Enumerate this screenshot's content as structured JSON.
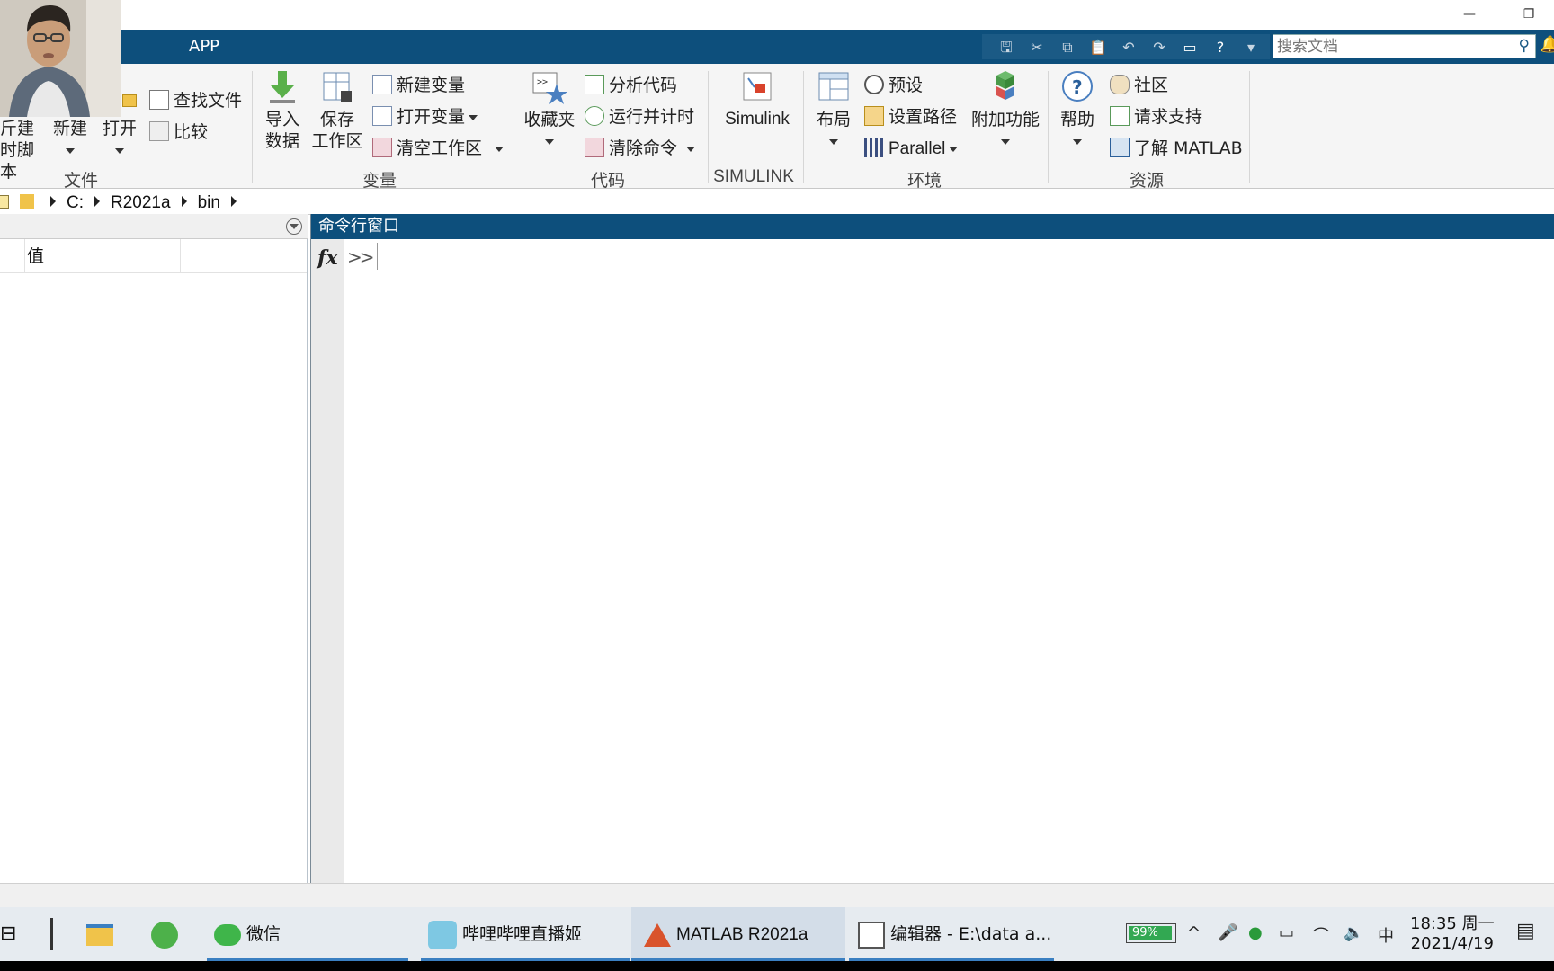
{
  "tabs": {
    "app": "APP"
  },
  "search": {
    "placeholder": "搜索文档"
  },
  "ribbon": {
    "file": {
      "label": "文件",
      "new_script_line1": "新建",
      "new_script_line2": "实时脚本",
      "new_script_visible1": "斤建",
      "new_script_visible2": "时脚本",
      "new": "新建",
      "open": "打开",
      "find_files": "查找文件",
      "compare": "比较"
    },
    "variable": {
      "label": "变量",
      "import_l1": "导入",
      "import_l2": "数据",
      "save_l1": "保存",
      "save_l2": "工作区",
      "new_var": "新建变量",
      "open_var": "打开变量",
      "clear_ws": "清空工作区"
    },
    "code": {
      "label": "代码",
      "favorites": "收藏夹",
      "analyze": "分析代码",
      "run_time": "运行并计时",
      "clear_cmd": "清除命令"
    },
    "simulink": {
      "label": "SIMULINK",
      "button": "Simulink"
    },
    "environment": {
      "label": "环境",
      "layout": "布局",
      "preferences": "预设",
      "set_path": "设置路径",
      "parallel": "Parallel",
      "addons": "附加功能"
    },
    "resources": {
      "label": "资源",
      "help": "帮助",
      "community": "社区",
      "support": "请求支持",
      "learn": "了解 MATLAB"
    }
  },
  "address": {
    "drive": "C:",
    "folder1": "R2021a",
    "folder2": "bin"
  },
  "workspace": {
    "col_value": "值"
  },
  "command_window": {
    "title": "命令行窗口",
    "fx": "fx",
    "prompt": ">>"
  },
  "taskbar": {
    "wechat": "微信",
    "bilibili": "哔哩哔哩直播姬",
    "matlab": "MATLAB R2021a",
    "editor": "编辑器 - E:\\data a...",
    "battery": "99%",
    "ime": "中",
    "time": "18:35 周一",
    "date": "2021/4/19"
  },
  "colors": {
    "title_blue": "#0d4f7c",
    "ribbon_bg": "#f5f5f5",
    "taskbar_bg": "#e6ebf0",
    "taskbar_accent": "#3a7fc1"
  }
}
